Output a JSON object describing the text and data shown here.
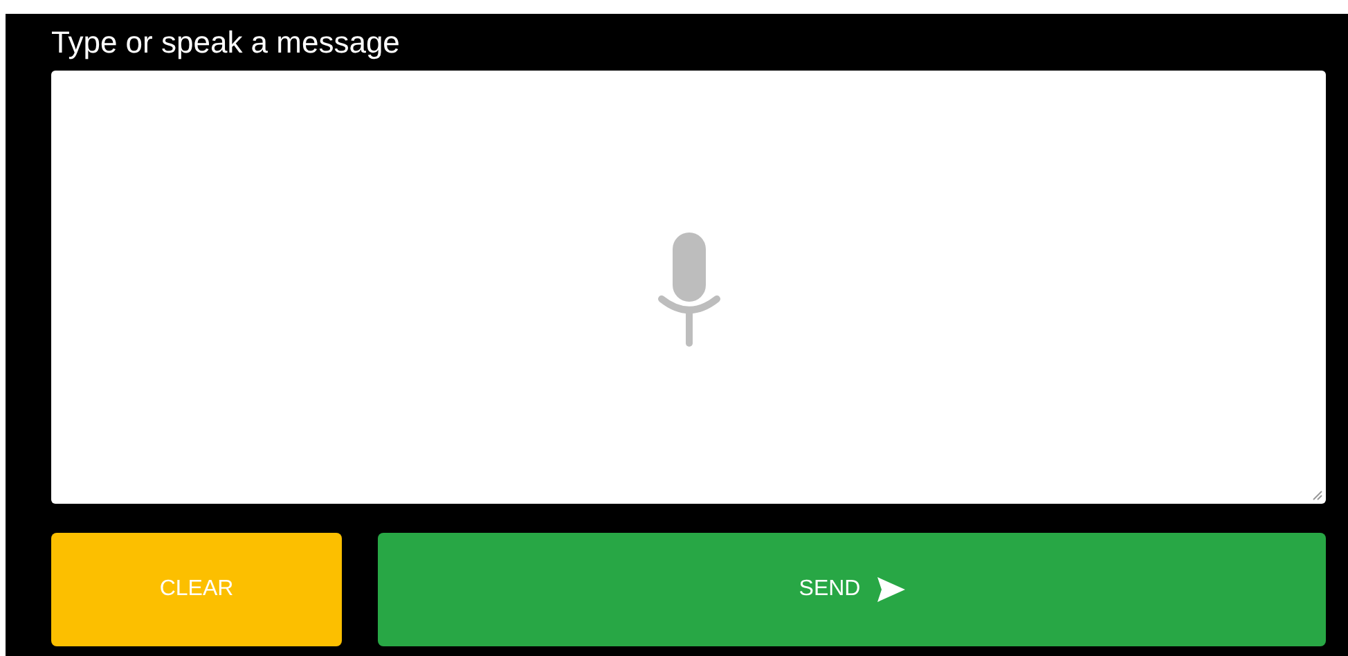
{
  "prompt": {
    "label": "Type or speak a message"
  },
  "buttons": [
    {
      "label": "CLEAR",
      "kind": "clear"
    },
    {
      "label": "SEND",
      "kind": "send"
    }
  ]
}
